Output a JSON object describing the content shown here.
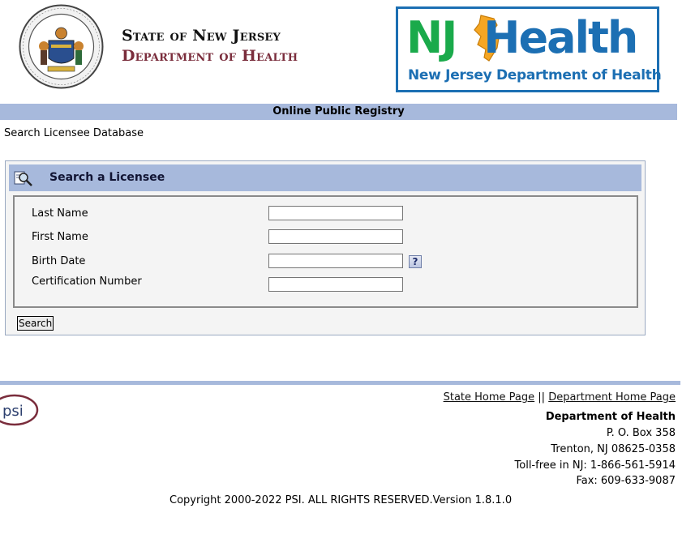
{
  "header": {
    "seal_alt": "Great Seal of the State of New Jersey",
    "state_line1": "State of New Jersey",
    "state_line2": "Department of Health",
    "logo": {
      "nj": "NJ",
      "health": "Health",
      "subtitle": "New Jersey Department of Health",
      "colors": {
        "green": "#1aaa4b",
        "blue": "#1c6fb3",
        "orange": "#f5a623"
      }
    }
  },
  "registry_bar": {
    "title": "Online Public Registry"
  },
  "breadcrumb": "Search Licensee Database",
  "search_panel": {
    "icon": "magnifier-document-icon",
    "title": "Search a Licensee",
    "fields": [
      {
        "label": "Last Name",
        "value": "",
        "placeholder": ""
      },
      {
        "label": "First Name",
        "value": "",
        "placeholder": ""
      },
      {
        "label": "Birth Date",
        "value": "",
        "placeholder": ""
      },
      {
        "label": "Certification Number",
        "value": "",
        "placeholder": ""
      }
    ],
    "help_glyph": "?",
    "search_label": "Search"
  },
  "footer": {
    "links": {
      "state_home": "State Home Page",
      "separator": "||",
      "dept_home": "Department Home Page"
    },
    "psi_logo": "psi",
    "address": {
      "org": "Department of Health",
      "box": "P. O. Box 358",
      "city": "Trenton, NJ 08625-0358",
      "tollfree": "Toll-free in NJ: 1-866-561-5914",
      "fax": "Fax: 609-633-9087"
    },
    "copyright": "Copyright 2000-2022 PSI. ALL RIGHTS RESERVED.Version 1.8.1.0"
  },
  "colors": {
    "bar_blue": "#a7b9dc",
    "state_maroon": "#7a2d3c"
  }
}
